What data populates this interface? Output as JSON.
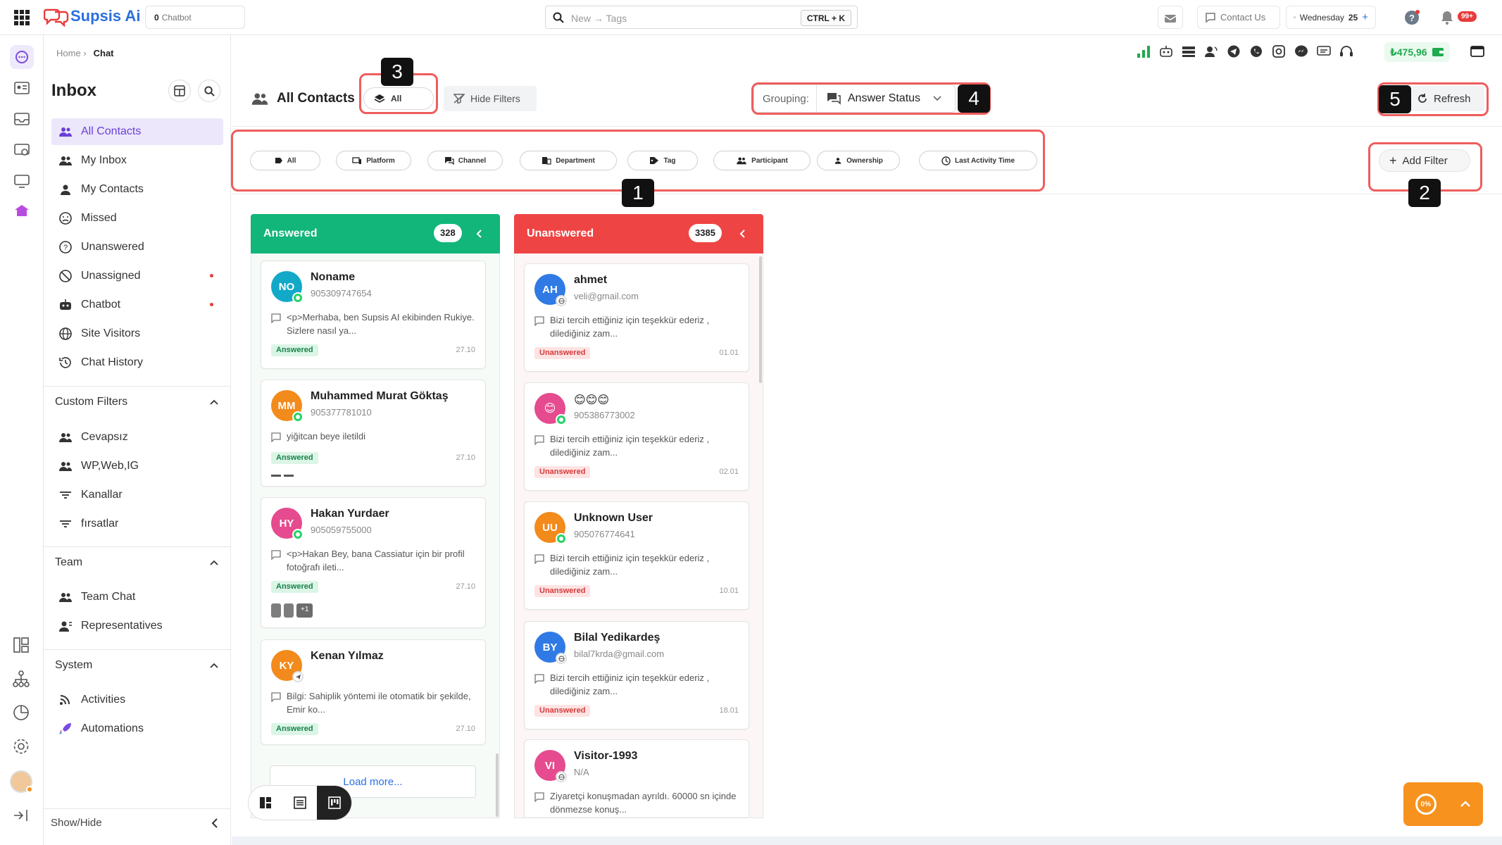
{
  "topbar": {
    "brand": "Supsis Ai",
    "chatbot_count": "0",
    "chatbot_label": "Chatbot",
    "search_placeholder": "New → Tags",
    "search_shortcut": "CTRL + K",
    "contact_us": "Contact Us",
    "date_label": "Wednesday",
    "date_day": "25",
    "notifications": "99+"
  },
  "breadcrumb": {
    "home": "Home ›",
    "current": "Chat"
  },
  "status_bar": {
    "balance": "₺475,96"
  },
  "sidebar": {
    "title": "Inbox",
    "items": [
      "All Contacts",
      "My Inbox",
      "My Contacts",
      "Missed",
      "Unanswered",
      "Unassigned",
      "Chatbot",
      "Site Visitors",
      "Chat History"
    ],
    "custom_filters": {
      "title": "Custom Filters",
      "items": [
        "Cevapsız",
        "WP,Web,IG",
        "Kanallar",
        "fırsatlar"
      ]
    },
    "team": {
      "title": "Team",
      "items": [
        "Team Chat",
        "Representatives"
      ]
    },
    "system": {
      "title": "System",
      "items": [
        "Activities",
        "Automations"
      ]
    },
    "show_hide": "Show/Hide"
  },
  "main": {
    "title": "All Contacts",
    "all_label": "All",
    "hide_filters": "Hide Filters",
    "grouping_label": "Grouping:",
    "grouping_value": "Answer Status",
    "refresh": "Refresh",
    "add_filter": "Add Filter",
    "filters": [
      "All",
      "Platform",
      "Channel",
      "Department",
      "Tag",
      "Participant",
      "Ownership",
      "Last Activity Time"
    ]
  },
  "annotations": [
    "1",
    "2",
    "3",
    "4",
    "5"
  ],
  "columns": {
    "answered": {
      "title": "Answered",
      "count": "328",
      "color": "#12b57a",
      "cards": [
        {
          "initials": "NO",
          "name": "Noname",
          "phone": "905309747654",
          "message": "<p>Merhaba, ben Supsis AI ekibinden Rukiye. Sizlere nasıl ya...",
          "status": "Answered",
          "date": "27.10",
          "avatar_color": "#12a9c9",
          "channel": "whatsapp"
        },
        {
          "initials": "MM",
          "name": "Muhammed Murat Göktaş",
          "phone": "905377781010",
          "message": "yiğitcan beye iletildi",
          "status": "Answered",
          "date": "27.10",
          "avatar_color": "#f28a1c",
          "channel": "whatsapp"
        },
        {
          "initials": "HY",
          "name": "Hakan Yurdaer",
          "phone": "905059755000",
          "message": "<p>Hakan Bey, bana Cassiatur için bir profil fotoğrafı ileti...",
          "status": "Answered",
          "date": "27.10",
          "avatar_color": "#e54b8e",
          "channel": "whatsapp",
          "more_tags": "+1"
        },
        {
          "initials": "KY",
          "name": "Kenan Yılmaz",
          "phone": "",
          "message": "Bilgi: Sahiplik yöntemi ile otomatik bir şekilde, Emir ko...",
          "status": "Answered",
          "date": "27.10",
          "avatar_color": "#f28a1c",
          "channel": "telegram"
        }
      ],
      "load_more": "Load more..."
    },
    "unanswered": {
      "title": "Unanswered",
      "count": "3385",
      "color": "#ef4444",
      "cards": [
        {
          "initials": "AH",
          "name": "ahmet",
          "phone": "veli@gmail.com",
          "message": "Bizi tercih ettiğiniz için teşekkür ederiz , dilediğiniz zam...",
          "status": "Unanswered",
          "date": "01.01",
          "avatar_color": "#2f7ae5",
          "channel": "web"
        },
        {
          "initials": "😊",
          "name": "😊😊😊",
          "phone": "905386773002",
          "message": "Bizi tercih ettiğiniz için teşekkür ederiz , dilediğiniz zam...",
          "status": "Unanswered",
          "date": "02.01",
          "avatar_color": "#e54b8e",
          "channel": "whatsapp"
        },
        {
          "initials": "UU",
          "name": "Unknown User",
          "phone": "905076774641",
          "message": "Bizi tercih ettiğiniz için teşekkür ederiz , dilediğiniz zam...",
          "status": "Unanswered",
          "date": "10.01",
          "avatar_color": "#f28a1c",
          "channel": "whatsapp"
        },
        {
          "initials": "BY",
          "name": "Bilal Yedikardeş",
          "phone": "bilal7krda@gmail.com",
          "message": "Bizi tercih ettiğiniz için teşekkür ederiz , dilediğiniz zam...",
          "status": "Unanswered",
          "date": "18.01",
          "avatar_color": "#2f7ae5",
          "channel": "web"
        },
        {
          "initials": "VI",
          "name": "Visitor-1993",
          "phone": "N/A",
          "message": "Ziyaretçi konuşmadan ayrıldı. 60000 sn içinde dönmezse konuş...",
          "status": "",
          "date": "",
          "avatar_color": "#e54b8e",
          "channel": "web"
        }
      ]
    }
  },
  "progress_widget": {
    "value": "0%"
  }
}
